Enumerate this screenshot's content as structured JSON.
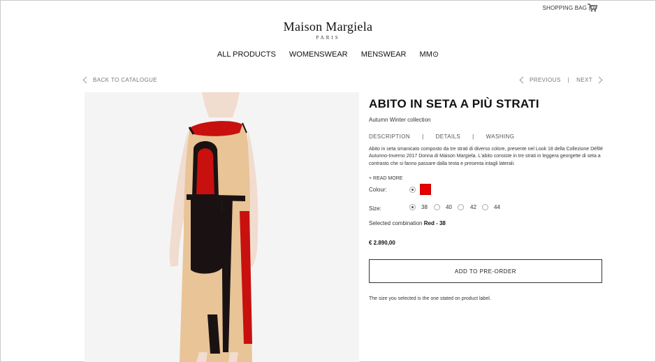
{
  "header": {
    "shopping_bag": "SHOPPING BAG (0)",
    "logo_main": "Maison Margiela",
    "logo_sub": "PARIS"
  },
  "nav": [
    "ALL PRODUCTS",
    "WOMENSWEAR",
    "MENSWEAR",
    "MM⊙"
  ],
  "back": "BACK TO CATALOGUE",
  "pager": {
    "previous": "PREVIOUS",
    "separator": "|",
    "next": "NEXT"
  },
  "product": {
    "title": "ABITO IN SETA A PIÙ STRATI",
    "collection": "Autumn Winter collection",
    "tabs": [
      "DESCRIPTION",
      "DETAILS",
      "WASHING"
    ],
    "tab_separator": "|",
    "description": "Abito in seta smanicato composto da tre strati di diverso colore, presente nel Look 18 della Collezione Défilé Autunno-Inverno 2017 Donna di Maison Margiela. L'abito consiste in tre strati in leggera georgette di seta a contrasto che si fanno passare dalla testa e presenta intagli laterali.",
    "read_more": "+ READ MORE",
    "colour_label": "Colour:",
    "colour_swatch": "#e60000",
    "size_label": "Size:",
    "sizes": [
      "38",
      "40",
      "42",
      "44"
    ],
    "selected_size": "38",
    "combo_label": "Selected combination",
    "combo_value": "Red - 38",
    "price": "€ 2.890,00",
    "cta": "ADD TO PRE-ORDER",
    "note": "The size you selected is the one stated on product label."
  },
  "colors": {
    "beige": "#e8c497",
    "red": "#c8100f",
    "black": "#1a1212",
    "skin": "#f1dcd0"
  }
}
